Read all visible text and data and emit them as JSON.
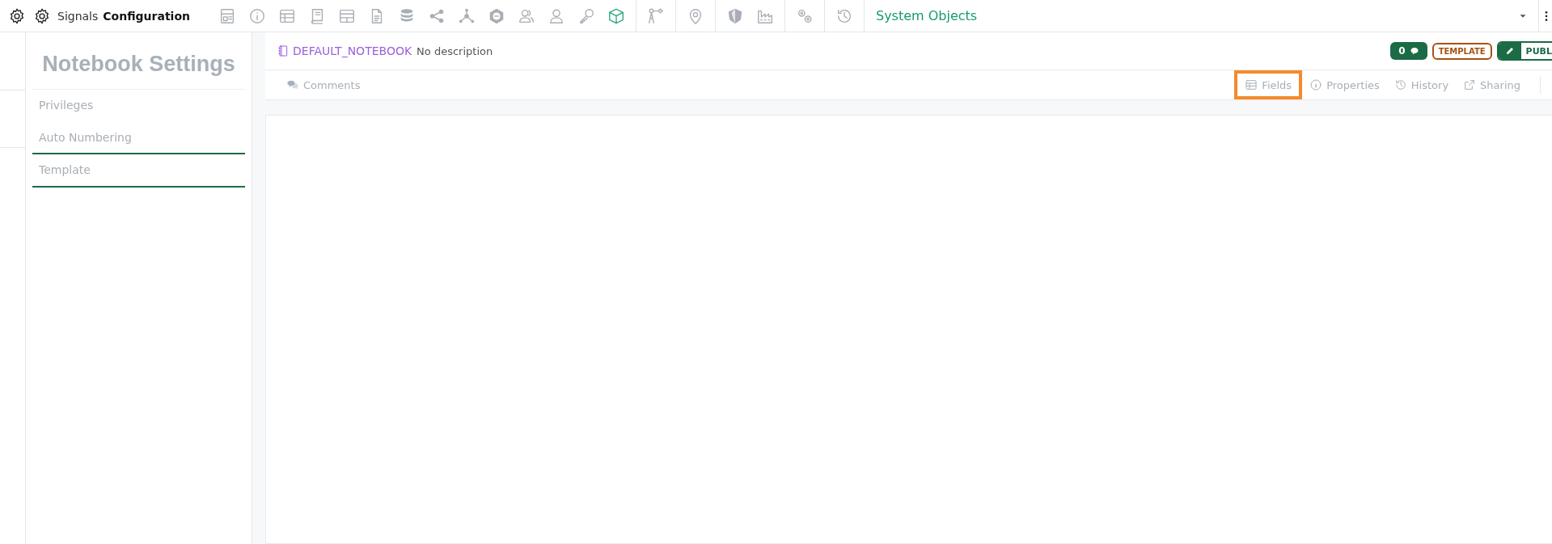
{
  "app": {
    "title_light": "Signals",
    "title_bold": "Configuration"
  },
  "toolbar": {
    "groups": [
      [
        {
          "kind": "layout",
          "active": false
        },
        {
          "kind": "info",
          "active": false
        },
        {
          "kind": "table",
          "active": false
        },
        {
          "kind": "book",
          "active": false
        },
        {
          "kind": "grid",
          "active": false
        },
        {
          "kind": "document",
          "active": false
        },
        {
          "kind": "database",
          "active": false
        },
        {
          "kind": "share",
          "active": false
        },
        {
          "kind": "network",
          "active": false
        },
        {
          "kind": "hexagon",
          "active": false
        },
        {
          "kind": "users",
          "active": false
        },
        {
          "kind": "user",
          "active": false
        },
        {
          "kind": "key",
          "active": false
        },
        {
          "kind": "cube",
          "active": true
        }
      ],
      [
        {
          "kind": "branch",
          "active": false
        }
      ],
      [
        {
          "kind": "pin",
          "active": false
        }
      ],
      [
        {
          "kind": "shield",
          "active": false
        },
        {
          "kind": "factory",
          "active": false
        }
      ],
      [
        {
          "kind": "gears",
          "active": false
        }
      ],
      [
        {
          "kind": "history",
          "active": false
        }
      ]
    ]
  },
  "object_selector": {
    "value": "System Objects"
  },
  "sidebar": {
    "title": "Notebook Settings",
    "items": [
      {
        "label": "Privileges",
        "selected": false
      },
      {
        "label": "Auto Numbering",
        "selected": false
      },
      {
        "label": "Template",
        "selected": true
      }
    ]
  },
  "header": {
    "name": "DEFAULT_NOTEBOOK",
    "description": "No description",
    "comment_count": "0",
    "type_badge": "TEMPLATE",
    "status_toggle": "PUBL"
  },
  "left_tabs": [
    {
      "label": "Comments",
      "kind": "comments"
    }
  ],
  "right_tabs": [
    {
      "label": "Fields",
      "kind": "fields",
      "highlighted": true
    },
    {
      "label": "Properties",
      "kind": "properties",
      "highlighted": false
    },
    {
      "label": "History",
      "kind": "history",
      "highlighted": false
    },
    {
      "label": "Sharing",
      "kind": "sharing",
      "highlighted": false
    }
  ]
}
